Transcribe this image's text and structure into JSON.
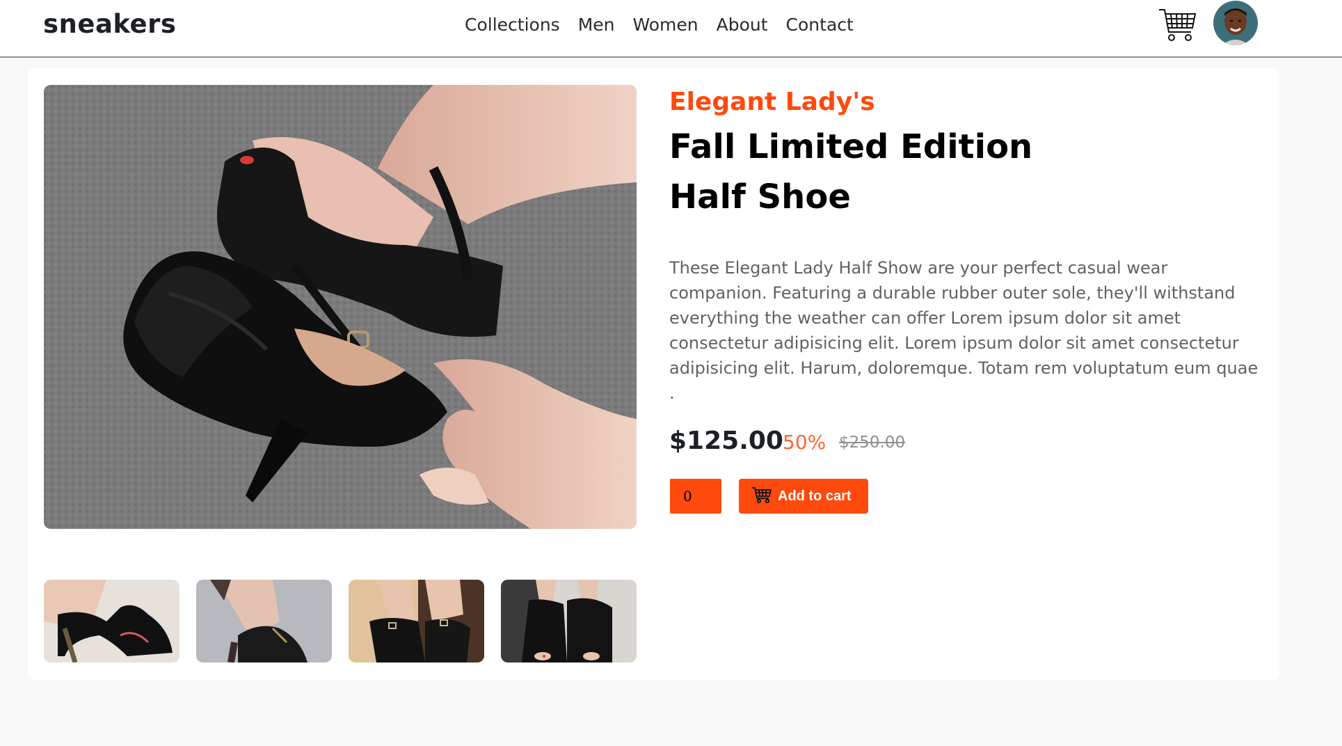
{
  "header": {
    "logo": "sneakers",
    "nav": [
      "Collections",
      "Men",
      "Women",
      "About",
      "Contact"
    ],
    "cart_icon": "cart-icon",
    "avatar": "user-avatar"
  },
  "product": {
    "brand": "Elegant Lady's",
    "title_line1": "Fall Limited Edition",
    "title_line2": "Half Shoe",
    "description": "These Elegant Lady Half Show are your perfect casual wear companion. Featuring a durable rubber outer sole, they'll withstand everything the weather can offer Lorem ipsum dolor sit amet consectetur adipisicing elit. Lorem ipsum dolor sit amet consectetur adipisicing elit. Harum, doloremque. Totam rem voluptatum eum quae .",
    "price": "$125.00",
    "discount": "50%",
    "original_price": "$250.00",
    "quantity": "0",
    "add_to_cart_label": "Add to cart"
  },
  "colors": {
    "accent": "#ff4a0d",
    "text_dark": "#1d2026",
    "text_muted": "#5f6166"
  }
}
